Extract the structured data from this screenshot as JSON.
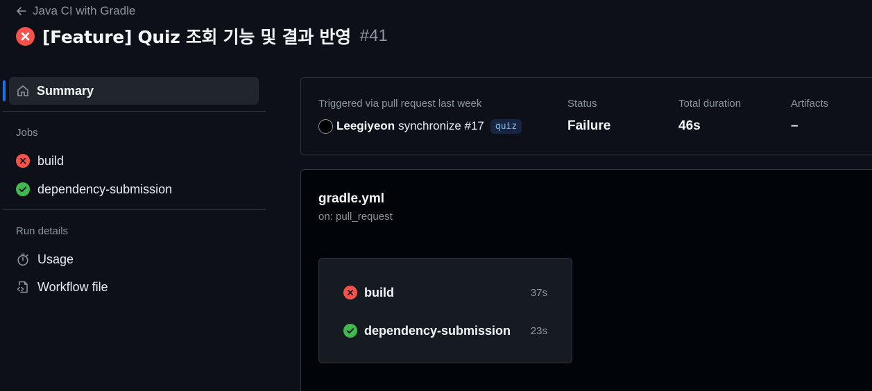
{
  "header": {
    "back_label": "Java CI with Gradle",
    "title": "[Feature] Quiz 조회 기능 및 결과 반영",
    "run_number": "#41"
  },
  "sidebar": {
    "summary_label": "Summary",
    "jobs_heading": "Jobs",
    "jobs": [
      {
        "name": "build",
        "status": "failure"
      },
      {
        "name": "dependency-submission",
        "status": "success"
      }
    ],
    "run_details_heading": "Run details",
    "details": [
      {
        "label": "Usage",
        "icon": "stopwatch-icon"
      },
      {
        "label": "Workflow file",
        "icon": "file-code-icon"
      }
    ]
  },
  "summary": {
    "trigger_label": "Triggered via pull request last week",
    "actor": "Leegiyeon",
    "event": "synchronize #17",
    "branch": "quiz",
    "status_label": "Status",
    "status_value": "Failure",
    "duration_label": "Total duration",
    "duration_value": "46s",
    "artifacts_label": "Artifacts",
    "artifacts_value": "–"
  },
  "workflow": {
    "file": "gradle.yml",
    "trigger": "on: pull_request",
    "jobs": [
      {
        "name": "build",
        "duration": "37s",
        "status": "failure"
      },
      {
        "name": "dependency-submission",
        "duration": "23s",
        "status": "success"
      }
    ]
  },
  "colors": {
    "background": "#0d1117",
    "failure": "#f85149",
    "success": "#3fb950",
    "accent": "#1f6feb"
  }
}
